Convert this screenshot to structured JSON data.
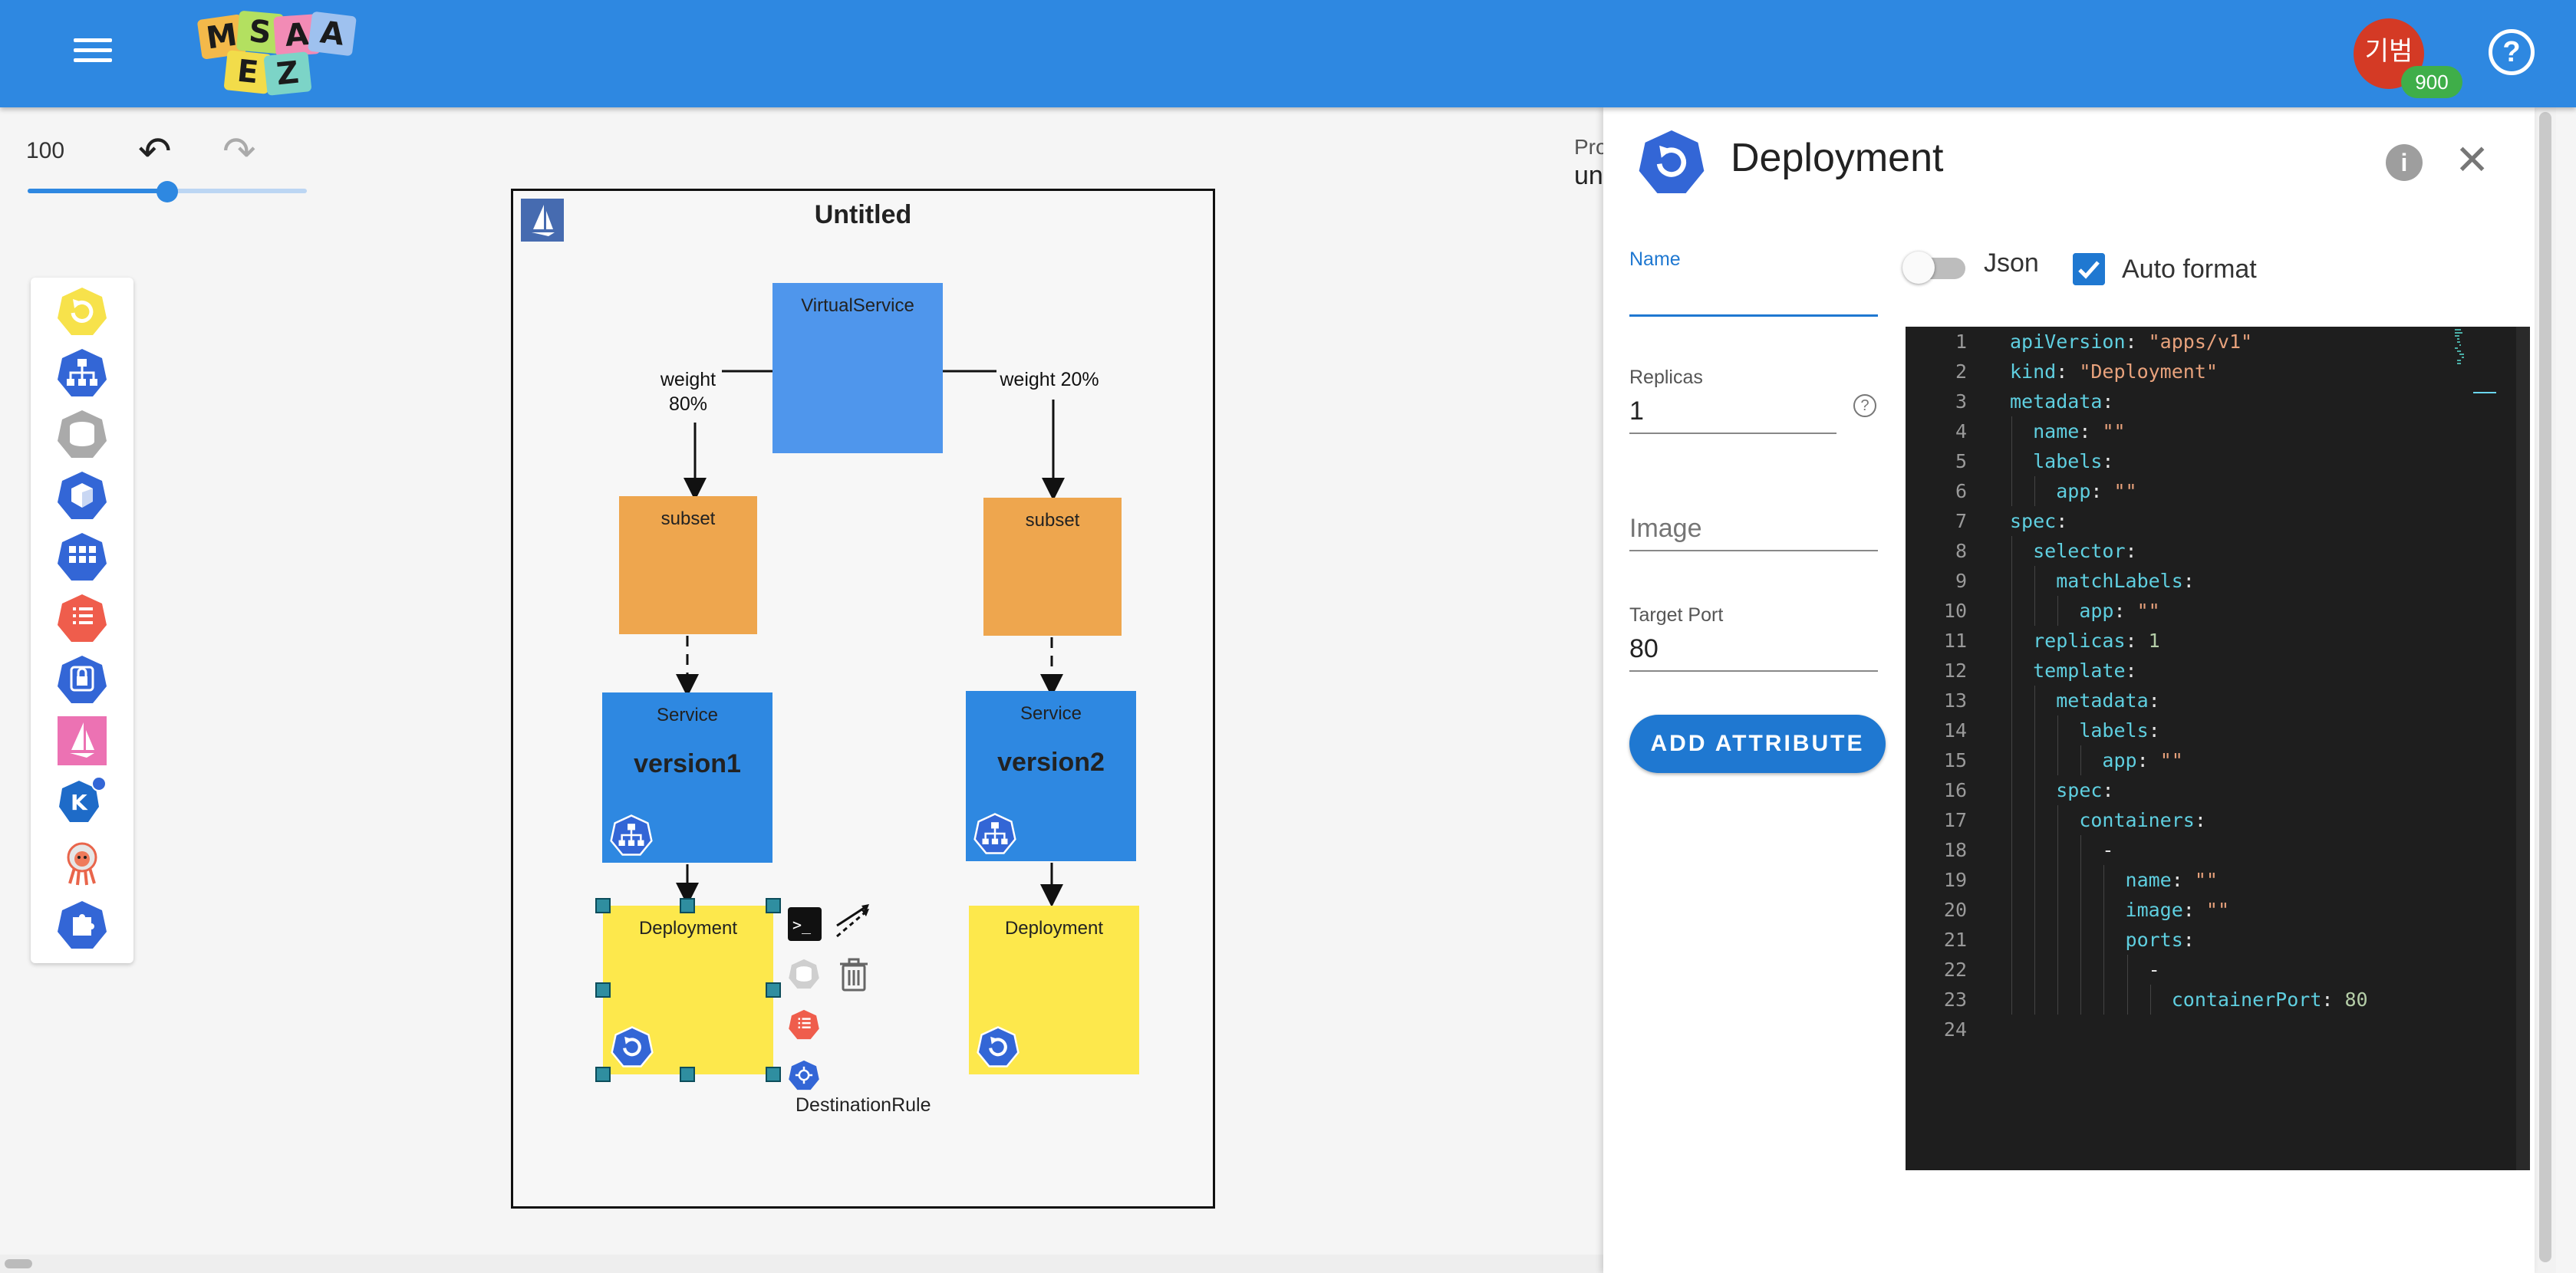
{
  "header": {
    "logo_letters": [
      "M",
      "S",
      "A",
      "E",
      "Z"
    ],
    "avatar_text": "기범",
    "avatar_badge": "900",
    "help_icon": "help-circle-icon"
  },
  "toolbar": {
    "zoom_value": "100",
    "zoom_level": 0.5,
    "undo_icon": "undo-icon",
    "redo_icon": "redo-icon"
  },
  "palette": {
    "items": [
      "deployment-icon",
      "service-icon",
      "persistent-volume-icon",
      "pod-icon",
      "replicaset-icon",
      "configmap-icon",
      "secret-icon",
      "istio-icon",
      "knative-icon",
      "argo-icon",
      "custom-resource-icon"
    ]
  },
  "canvas": {
    "title": "Untitled",
    "nodes": {
      "virtual_service": "VirtualService",
      "subset_left": "subset",
      "subset_right": "subset",
      "service_left_type": "Service",
      "service_left_name": "version1",
      "service_right_type": "Service",
      "service_right_name": "version2",
      "deployment_left": "Deployment",
      "deployment_right": "Deployment"
    },
    "edges": {
      "weight_left": "weight\n80%",
      "weight_left_line1": "weight",
      "weight_left_line2": "80%",
      "weight_right": "weight 20%"
    },
    "context_menu": {
      "destination_rule_label": "DestinationRule"
    }
  },
  "behind_panel": {
    "line1": "Pro",
    "line2": "un"
  },
  "panel": {
    "title": "Deployment",
    "fields": {
      "name_label": "Name",
      "name_value": "",
      "replicas_label": "Replicas",
      "replicas_value": "1",
      "image_placeholder": "Image",
      "image_value": "",
      "target_port_label": "Target Port",
      "target_port_value": "80"
    },
    "add_attribute": "ADD ATTRIBUTE",
    "json_label": "Json",
    "json_on": false,
    "auto_format_label": "Auto format",
    "auto_format_on": true,
    "code_lines": [
      [
        [
          "k",
          "apiVersion"
        ],
        [
          "p",
          ": "
        ],
        [
          "s",
          "\"apps/v1\""
        ]
      ],
      [
        [
          "k",
          "kind"
        ],
        [
          "p",
          ": "
        ],
        [
          "s",
          "\"Deployment\""
        ]
      ],
      [
        [
          "k",
          "metadata"
        ],
        [
          "p",
          ":"
        ]
      ],
      [
        [
          "p",
          "  "
        ],
        [
          "k",
          "name"
        ],
        [
          "p",
          ": "
        ],
        [
          "s",
          "\"\""
        ]
      ],
      [
        [
          "p",
          "  "
        ],
        [
          "k",
          "labels"
        ],
        [
          "p",
          ":"
        ]
      ],
      [
        [
          "p",
          "    "
        ],
        [
          "k",
          "app"
        ],
        [
          "p",
          ": "
        ],
        [
          "s",
          "\"\""
        ]
      ],
      [
        [
          "k",
          "spec"
        ],
        [
          "p",
          ":"
        ]
      ],
      [
        [
          "p",
          "  "
        ],
        [
          "k",
          "selector"
        ],
        [
          "p",
          ":"
        ]
      ],
      [
        [
          "p",
          "    "
        ],
        [
          "k",
          "matchLabels"
        ],
        [
          "p",
          ":"
        ]
      ],
      [
        [
          "p",
          "      "
        ],
        [
          "k",
          "app"
        ],
        [
          "p",
          ": "
        ],
        [
          "s",
          "\"\""
        ]
      ],
      [
        [
          "p",
          "  "
        ],
        [
          "k",
          "replicas"
        ],
        [
          "p",
          ": "
        ],
        [
          "n",
          "1"
        ]
      ],
      [
        [
          "p",
          "  "
        ],
        [
          "k",
          "template"
        ],
        [
          "p",
          ":"
        ]
      ],
      [
        [
          "p",
          "    "
        ],
        [
          "k",
          "metadata"
        ],
        [
          "p",
          ":"
        ]
      ],
      [
        [
          "p",
          "      "
        ],
        [
          "k",
          "labels"
        ],
        [
          "p",
          ":"
        ]
      ],
      [
        [
          "p",
          "        "
        ],
        [
          "k",
          "app"
        ],
        [
          "p",
          ": "
        ],
        [
          "s",
          "\"\""
        ]
      ],
      [
        [
          "p",
          "    "
        ],
        [
          "k",
          "spec"
        ],
        [
          "p",
          ":"
        ]
      ],
      [
        [
          "p",
          "      "
        ],
        [
          "k",
          "containers"
        ],
        [
          "p",
          ":"
        ]
      ],
      [
        [
          "p",
          "        -"
        ]
      ],
      [
        [
          "p",
          "          "
        ],
        [
          "k",
          "name"
        ],
        [
          "p",
          ": "
        ],
        [
          "s",
          "\"\""
        ]
      ],
      [
        [
          "p",
          "          "
        ],
        [
          "k",
          "image"
        ],
        [
          "p",
          ": "
        ],
        [
          "s",
          "\"\""
        ]
      ],
      [
        [
          "p",
          "          "
        ],
        [
          "k",
          "ports"
        ],
        [
          "p",
          ":"
        ]
      ],
      [
        [
          "p",
          "            -"
        ]
      ],
      [
        [
          "p",
          "              "
        ],
        [
          "k",
          "containerPort"
        ],
        [
          "p",
          ": "
        ],
        [
          "n",
          "80"
        ]
      ],
      [
        [
          "p",
          ""
        ]
      ]
    ]
  },
  "colors": {
    "header": "#2e88e1",
    "virtual_service": "#4f96ec",
    "subset": "#eea64e",
    "service": "#2e88e1",
    "deployment": "#fde84c",
    "k8s_blue": "#3366d6",
    "accent": "#1f78d1"
  }
}
